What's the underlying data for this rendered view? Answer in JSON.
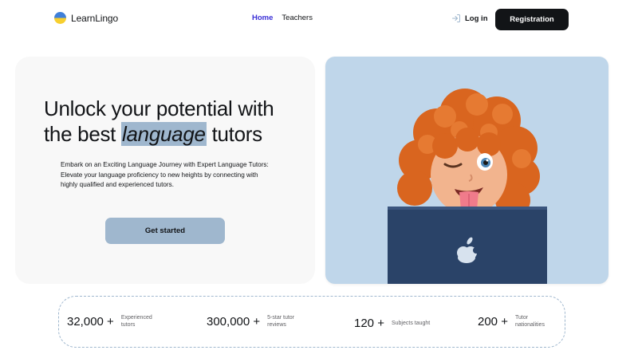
{
  "colors": {
    "accent": "#9fb7ce",
    "dark": "#121417",
    "nav_active": "#3a2fd6",
    "hero_left_bg": "#f8f8f8",
    "hero_right_bg": "#bfd6ea"
  },
  "header": {
    "logo_icon": "ukraine-flag-circle-icon",
    "brand": "LearnLingo",
    "nav": [
      {
        "label": "Home",
        "active": true
      },
      {
        "label": "Teachers",
        "active": false
      }
    ],
    "login_icon": "log-in-icon",
    "login_label": "Log in",
    "registration_label": "Registration"
  },
  "hero": {
    "title_before": "Unlock your potential with the best ",
    "title_highlight": "language",
    "title_after": " tutors",
    "description": "Embark on an Exciting Language Journey with Expert Language Tutors: Elevate your language proficiency to new heights by connecting with highly qualified and experienced tutors.",
    "cta_label": "Get started",
    "image": "memoji-girl-with-laptop"
  },
  "stats": [
    {
      "value": "32,000 +",
      "label": "Experienced tutors"
    },
    {
      "value": "300,000 +",
      "label": "5-star tutor reviews"
    },
    {
      "value": "120 +",
      "label": "Subjects taught"
    },
    {
      "value": "200 +",
      "label": "Tutor nationalities"
    }
  ]
}
